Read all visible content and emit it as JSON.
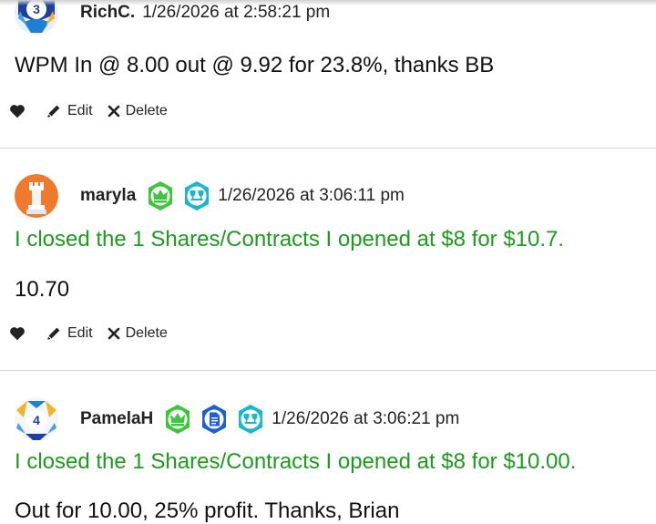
{
  "comments": [
    {
      "author": "RichC.",
      "timestamp": "1/26/2026 at 2:58:21 pm",
      "body": "WPM In @ 8.00 out @ 9.92 for 23.8%, thanks BB",
      "avatar_icon": "level-3-avatar-icon",
      "avatar_level": "3",
      "badges": []
    },
    {
      "author": "maryla",
      "timestamp": "1/26/2026 at 3:06:11 pm",
      "trade_notice": "I closed the 1 Shares/Contracts I opened at $8 for $10.7.",
      "body": "10.70",
      "avatar_icon": "chess-rook-avatar-icon",
      "badges": [
        "crown-badge-icon",
        "trophy-badge-icon"
      ]
    },
    {
      "author": "PamelaH",
      "timestamp": "1/26/2026 at 3:06:21 pm",
      "trade_notice": "I closed the 1 Shares/Contracts I opened at $8 for $10.00.",
      "body": "Out for 10.00, 25% profit. Thanks, Brian",
      "avatar_icon": "level-4-avatar-icon",
      "avatar_level": "4",
      "badges": [
        "crown-badge-icon",
        "document-badge-icon",
        "trophy-badge-icon"
      ]
    }
  ],
  "actions": {
    "like_icon": "heart-icon",
    "edit_label": "Edit",
    "delete_label": "Delete"
  },
  "colors": {
    "trade_notice": "#1d9a1d",
    "divider": "#d6d6d6",
    "badge_green": "#3cc63c",
    "badge_blue": "#1f5fd6",
    "badge_teal": "#19b6cc",
    "avatar_orange": "#f07a2c"
  }
}
